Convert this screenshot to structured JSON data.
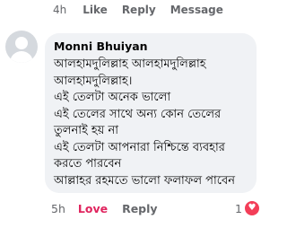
{
  "top_actions": {
    "time": "4h",
    "like": "Like",
    "reply": "Reply",
    "message": "Message"
  },
  "comment": {
    "author": "Monni Bhuiyan",
    "lines": [
      "আলহামদুলিল্লাহ আলহামদুলিল্লাহ",
      "আলহামদুলিল্লাহ।",
      "এই তেলটা অনেক ভালো",
      "এই তেলের সাথে অন্য কোন তেলের",
      "তুলনাই হয় না",
      "এই তেলটা আপনারা নিশ্চিন্তে ব্যবহার",
      "করতে পারবেন",
      "আল্লাহর রহমতে ভালো ফলাফল পাবেন"
    ],
    "time": "5h",
    "love": "Love",
    "reply": "Reply",
    "reaction_count": "1",
    "reaction_icon": "heart-icon",
    "love_color": "#e0245e",
    "reaction_color": "#f33e58"
  }
}
